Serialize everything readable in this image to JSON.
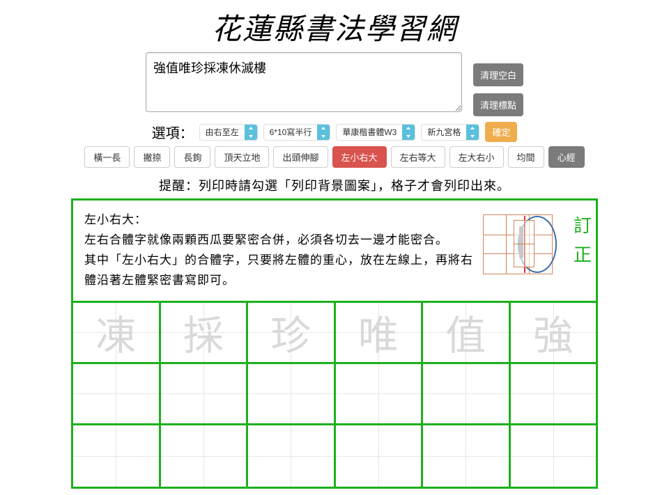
{
  "title": "花蓮縣書法學習網",
  "textarea_value": "強值唯珍採凍休滅樓",
  "side_buttons": {
    "clear_blank": "清理空白",
    "clear_punct": "清理標點"
  },
  "options": {
    "label": "選項：",
    "direction": "由右至左",
    "layout": "6*10寫半行",
    "font": "華康楷書體W3",
    "grid_style": "新九宮格",
    "confirm": "確定"
  },
  "style_buttons": [
    {
      "label": "橫一長",
      "key": "heng"
    },
    {
      "label": "撇捺",
      "key": "piena"
    },
    {
      "label": "長鉤",
      "key": "changgou"
    },
    {
      "label": "頂天立地",
      "key": "dingtian"
    },
    {
      "label": "出頭伸腳",
      "key": "chutou"
    },
    {
      "label": "左小右大",
      "key": "zxyd",
      "active": true
    },
    {
      "label": "左右等大",
      "key": "zydd"
    },
    {
      "label": "左大右小",
      "key": "zdyx"
    },
    {
      "label": "均間",
      "key": "junjian"
    },
    {
      "label": "心經",
      "key": "xinjing",
      "dark": true
    }
  ],
  "reminder": "提醒：列印時請勾選「列印背景圖案」，格子才會列印出來。",
  "info": {
    "heading": "左小右大：",
    "line1": "左右合體字就像兩顆西瓜要緊密合併，必須各切去一邊才能密合。",
    "line2": "其中「左小右大」的合體字，只要將左體的重心，放在左線上，再將右體沿著左體緊密書寫即可。"
  },
  "side_label": {
    "c1": "訂",
    "c2": "正"
  },
  "practice_chars": [
    "凍",
    "採",
    "珍",
    "唯",
    "值",
    "強"
  ]
}
